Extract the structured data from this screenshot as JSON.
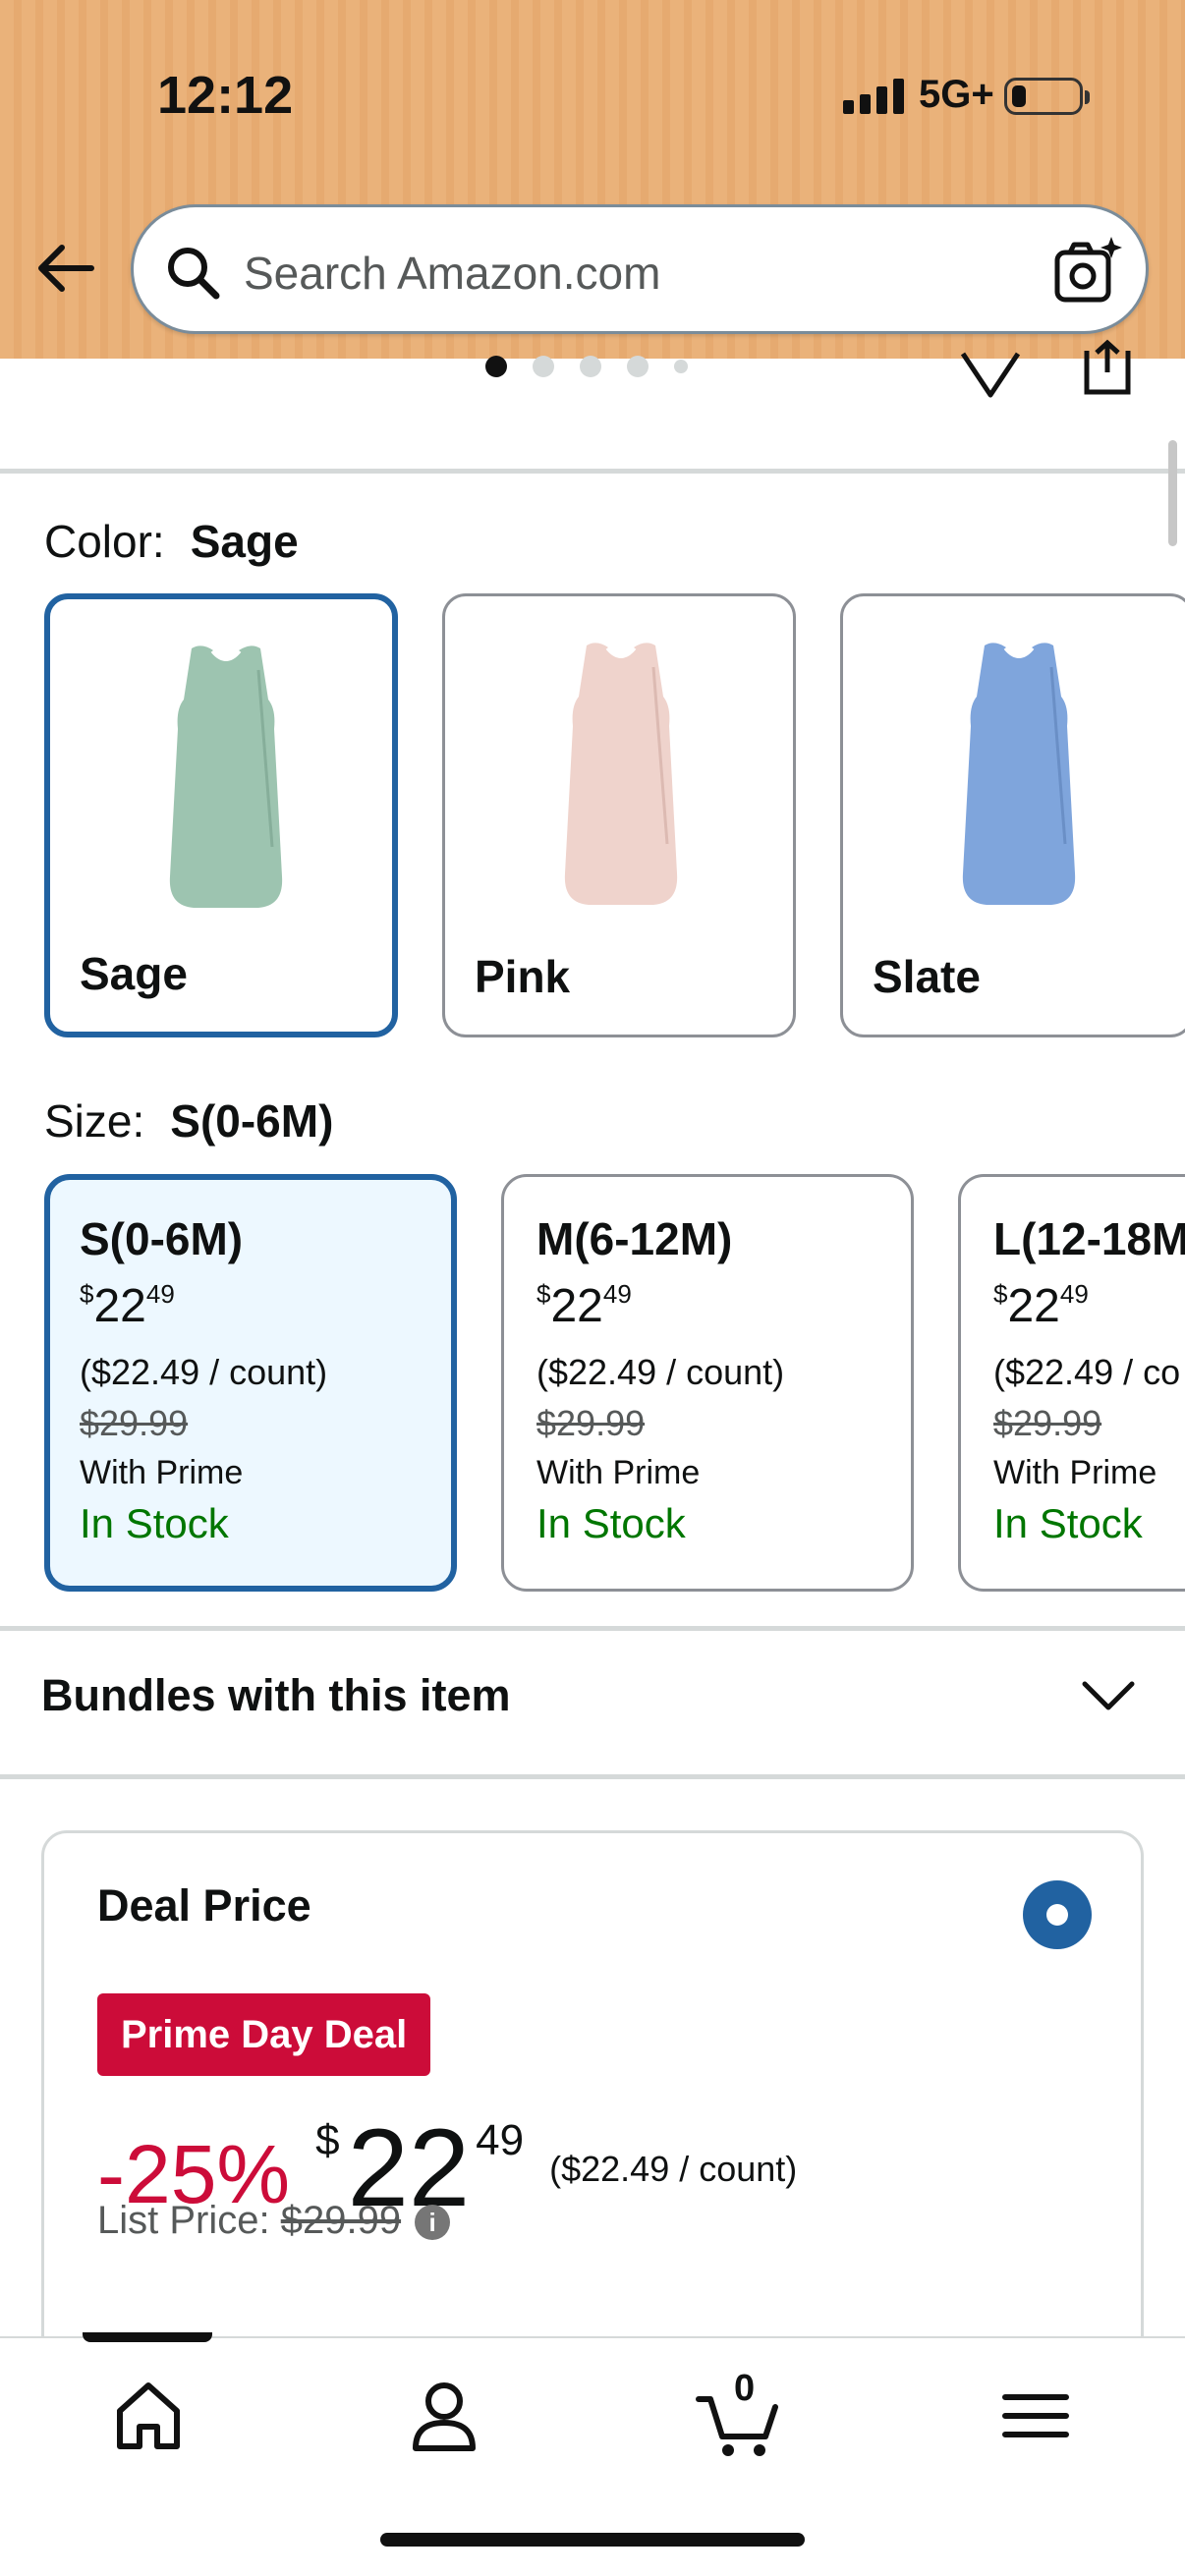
{
  "status_bar": {
    "time": "12:12",
    "network": "5G+"
  },
  "search": {
    "placeholder": "Search Amazon.com"
  },
  "gallery": {
    "dot_count": 5,
    "active_index": 0
  },
  "color": {
    "label": "Color:",
    "selected": "Sage",
    "options": [
      {
        "name": "Sage",
        "color": "#9dc4b0"
      },
      {
        "name": "Pink",
        "color": "#efd3cc"
      },
      {
        "name": "Slate",
        "color": "#7fa5dc"
      }
    ]
  },
  "size": {
    "label": "Size:",
    "selected": "S(0-6M)",
    "options": [
      {
        "name": "S(0-6M)",
        "price_dollars": "22",
        "price_cents": "49",
        "unit_price": "($22.49 / count)",
        "list_price": "$29.99",
        "prime": "With Prime",
        "stock": "In Stock"
      },
      {
        "name": "M(6-12M)",
        "price_dollars": "22",
        "price_cents": "49",
        "unit_price": "($22.49 / count)",
        "list_price": "$29.99",
        "prime": "With Prime",
        "stock": "In Stock"
      },
      {
        "name": "L(12-18M",
        "price_dollars": "22",
        "price_cents": "49",
        "unit_price": "($22.49 / co",
        "list_price": "$29.99",
        "prime": "With Prime",
        "stock": "In Stock"
      }
    ]
  },
  "bundles": {
    "label": "Bundles with this item"
  },
  "deal": {
    "title": "Deal Price",
    "badge": "Prime Day Deal",
    "discount": "-25%",
    "currency": "$",
    "price_dollars": "22",
    "price_cents": "49",
    "unit_price": "($22.49 / count)",
    "list_price_label": "List Price:",
    "list_price": "$29.99",
    "info_icon": "i"
  },
  "tabbar": {
    "cart_count": "0"
  },
  "colors": {
    "accent": "#2162a1",
    "deal_red": "#cc0c39",
    "stock_green": "#007600",
    "header_bg": "#eab27a"
  }
}
